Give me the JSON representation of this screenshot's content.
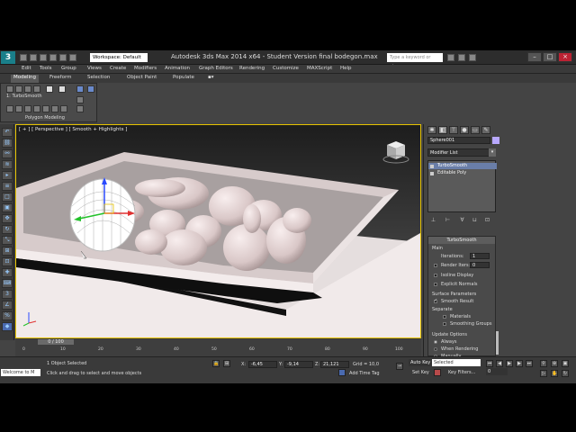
{
  "title_bar": {
    "logo": "3",
    "workspace": "Workspace: Default",
    "app_title": "Autodesk 3ds Max  2014 x64  -  Student Version    final bodegon.max",
    "search_placeholder": "Type a keyword or phrase"
  },
  "menu": [
    "Edit",
    "Tools",
    "Group",
    "Views",
    "Create",
    "Modifiers",
    "Animation",
    "Graph Editors",
    "Rendering",
    "Customize",
    "MAXScript",
    "Help"
  ],
  "ribbon": {
    "tabs": [
      "Modeling",
      "Freeform",
      "Selection",
      "Object Paint",
      "Populate"
    ],
    "modifier_label": "1: TurboSmooth",
    "panel_label": "Polygon Modeling"
  },
  "viewport": {
    "label": "[ + ] [ Perspective ] [ Smooth + Highlights ]"
  },
  "command_panel": {
    "object_name": "Sphere001",
    "modifier_list": "Modifier List",
    "stack": [
      "TurboSmooth",
      "Editable Poly"
    ],
    "rollout": {
      "title": "TurboSmooth",
      "main": "Main",
      "iterations_label": "Iterations:",
      "iterations_value": "1",
      "render_iters_label": "Render Iters:",
      "render_iters_value": "0",
      "isoline": "Isoline Display",
      "explicit_normals": "Explicit Normals",
      "surface_params": "Surface Parameters",
      "smooth_result": "Smooth Result",
      "separate": "Separate",
      "materials": "Materials",
      "smoothing_groups": "Smoothing Groups",
      "update_options": "Update Options",
      "always": "Always",
      "when_rendering": "When Rendering",
      "manually": "Manually"
    }
  },
  "timeline": {
    "slider": "0 / 100",
    "ticks": [
      "0",
      "10",
      "20",
      "30",
      "40",
      "50",
      "60",
      "70",
      "80",
      "90",
      "100"
    ]
  },
  "status": {
    "maxscript": "Welcome to M",
    "objects_selected": "1 Object Selected",
    "prompt": "Click and drag to select and move objects",
    "x_label": "X:",
    "x_value": "-6,45",
    "y_label": "Y:",
    "y_value": "-9,14",
    "z_label": "Z:",
    "z_value": "21,121",
    "grid": "Grid = 10,0",
    "add_time_tag": "Add Time Tag",
    "auto_key": "Auto Key",
    "selected": "Selected",
    "set_key": "Set Key",
    "key_filters": "Key Filters...",
    "frame": "0"
  }
}
